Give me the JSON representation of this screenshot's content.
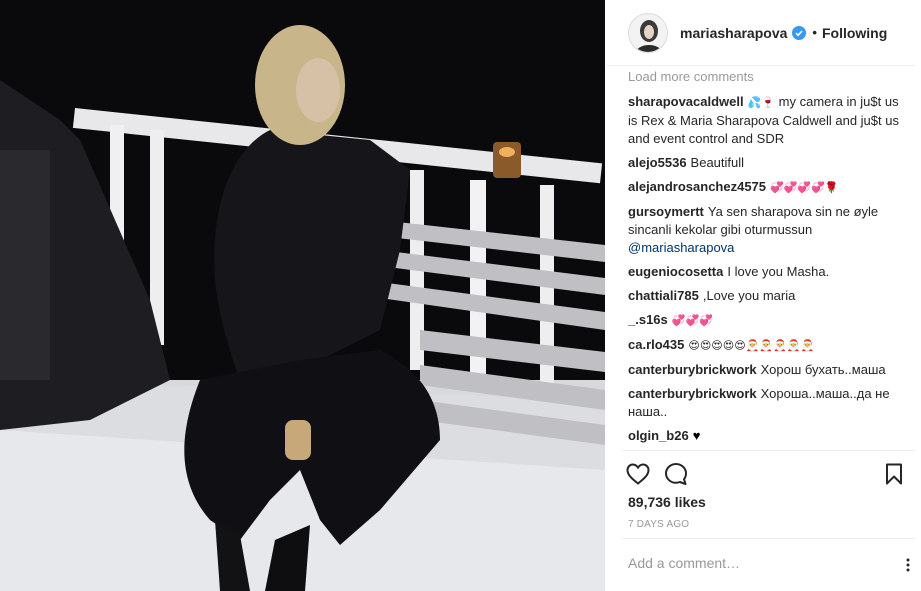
{
  "post": {
    "photo": {
      "name": "post-photo",
      "icon": "photo-of-woman-on-porch"
    },
    "header": {
      "username": "mariasharapova",
      "verified_icon": "verified-badge-icon",
      "separator": "•",
      "follow_state": "Following"
    },
    "comments": {
      "load_more_label": "Load more comments",
      "items": [
        {
          "user": "sharapovacaldwell",
          "text_prefix": "💦🍷",
          "text": " my camera in ju$t us is Rex & Maria Sharapova Caldwell and ju$t us and event control and SDR"
        },
        {
          "user": "alejo5536",
          "text": "Beautifull"
        },
        {
          "user": "alejandrosanchez4575",
          "text": "💞💞💞💞🌹"
        },
        {
          "user": "gursoymertt",
          "text": "Ya sen sharapova sin ne øyle sincanli kekolar gibi oturmussun",
          "mention": "@mariasharapova"
        },
        {
          "user": "eugeniocosetta",
          "text": "I love you Masha."
        },
        {
          "user": "chattiali785",
          "text": ",Love you maria"
        },
        {
          "user": "_.s16s",
          "text": "💞💞💞"
        },
        {
          "user": "ca.rlo435",
          "text": "😍😍😍😍😍🎅🎅🎅🎅🎅"
        },
        {
          "user": "canterburybrickwork",
          "text": "Хорош бухать..маша"
        },
        {
          "user": "canterburybrickwork",
          "text": "Хороша..маша..да не наша.."
        },
        {
          "user": "olgin_b26",
          "text": "♥"
        }
      ]
    },
    "actions": {
      "like_icon": "heart-outline-icon",
      "comment_icon": "comment-bubble-icon",
      "save_icon": "bookmark-icon"
    },
    "likes_text": "89,736 likes",
    "timestamp": "7 DAYS AGO",
    "add_comment": {
      "placeholder": "Add a comment…",
      "more_icon": "more-options-icon"
    }
  }
}
